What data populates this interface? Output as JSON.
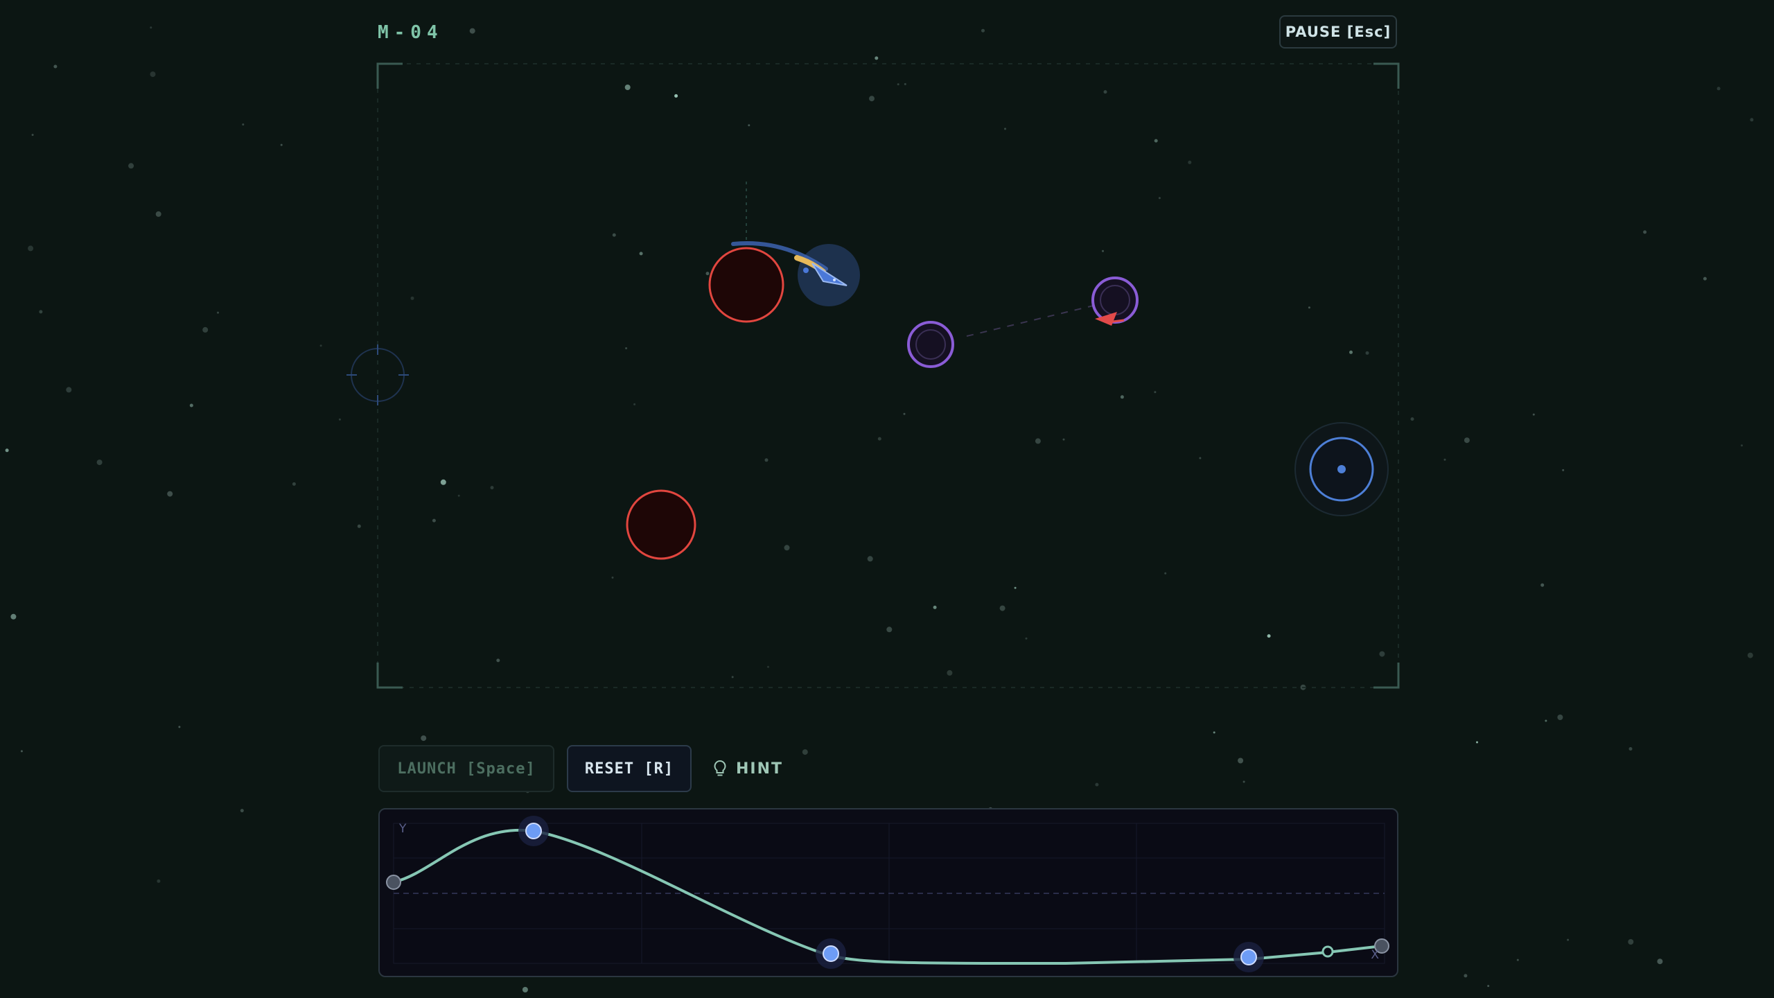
{
  "level": {
    "label": "M-04"
  },
  "pause_button": {
    "label": "PAUSE [Esc]"
  },
  "controls": {
    "launch_label": "LAUNCH [Space]",
    "reset_label": "RESET [R]",
    "hint_label": "HINT",
    "launch_enabled": false
  },
  "curve_editor": {
    "y_axis_label": "Y",
    "x_axis_label": "X",
    "control_points_active": 4,
    "control_points_endpoints": 2
  },
  "icons": {
    "hint": "lightbulb-icon",
    "ship": "arrow-ship-icon",
    "target": "target-ring-icon",
    "spawn": "crosshair-icon"
  },
  "colors": {
    "background": "#0c1613",
    "accent_green": "#7fc4a8",
    "curve": "#86c7b4",
    "hazard_red": "#e2463f",
    "portal_purple": "#8a5cd6",
    "target_blue": "#4d7fd6",
    "ship_blue": "#4a78d8",
    "enemy_red": "#e24a4a",
    "control_point": "#6d9cf5"
  }
}
